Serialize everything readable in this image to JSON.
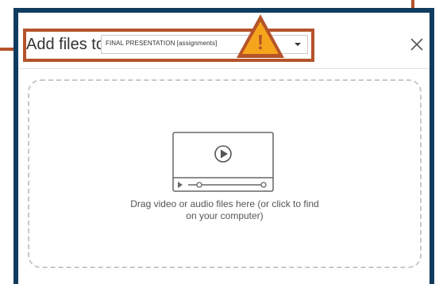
{
  "dialog": {
    "title": "Add files to",
    "library_select": {
      "value": "FINAL PRESENTATION [assignments]"
    },
    "close_label": "×",
    "warning_symbol": "!"
  },
  "drop_zone": {
    "line1": "Drag video or audio files here (or click to find",
    "line2": "on your computer)"
  },
  "colors": {
    "dialog_border": "#0f3b5f",
    "callout_accent": "#b5532a",
    "warning_fill": "#f5a51c",
    "dashed_border": "#c9c9c9"
  },
  "icons": {
    "warning": "warning-triangle-icon",
    "close": "close-icon",
    "dropdown": "chevron-down-icon",
    "media": "video-player-icon"
  }
}
